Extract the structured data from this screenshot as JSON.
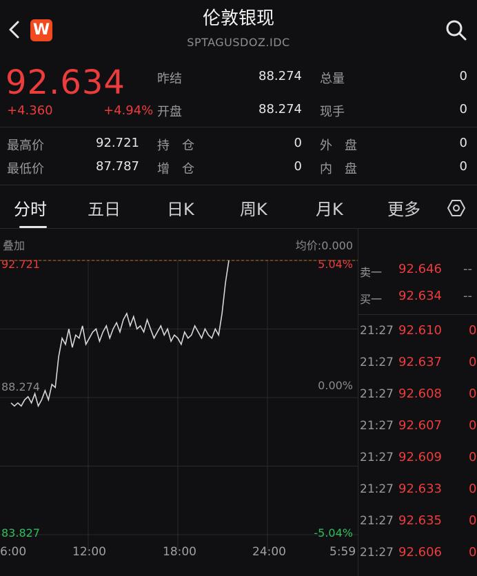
{
  "header": {
    "title": "伦敦银现",
    "symbol": "SPTAGUSDOZ.IDC",
    "logo_letter": "W",
    "icons": [
      "back-chevron-icon",
      "app-logo-icon",
      "search-icon"
    ]
  },
  "quote": {
    "price": "92.634",
    "change": "+4.360",
    "change_pct": "+4.94%",
    "stats": {
      "prev_close_label": "昨结",
      "prev_close": "88.274",
      "total_vol_label": "总量",
      "total_vol": "0",
      "open_label": "开盘",
      "open": "88.274",
      "cur_vol_label": "现手",
      "cur_vol": "0",
      "high_label": "最高价",
      "high": "92.721",
      "hold_label": "持　仓",
      "hold": "0",
      "outer_label": "外　盘",
      "outer": "0",
      "low_label": "最低价",
      "low": "87.787",
      "add_label": "增　仓",
      "add": "0",
      "inner_label": "内　盘",
      "inner": "0"
    }
  },
  "tabs": [
    "分时",
    "五日",
    "日K",
    "周K",
    "月K",
    "更多"
  ],
  "active_tab": 0,
  "chart": {
    "overlay_label": "叠加",
    "avg_label": "均价:0.000",
    "top_price": "92.721",
    "mid_price": "88.274",
    "bottom_price": "83.827",
    "top_pct": "5.04%",
    "mid_pct": "0.00%",
    "bottom_pct": "-5.04%",
    "x_ticks": [
      "6:00",
      "12:00",
      "18:00",
      "24:00",
      "5:59"
    ],
    "colors": {
      "line": "#d8d8d8",
      "up": "#ec3c3c",
      "down": "#2fbf5a",
      "grid": "#2a2a2e",
      "ref": "#c8761e"
    }
  },
  "chart_data": {
    "type": "line",
    "ylim": [
      83.827,
      92.721
    ],
    "reference": 88.274,
    "x": [
      "6:00",
      "12:00",
      "18:00",
      "24:00",
      "5:59"
    ],
    "series": [
      {
        "values": [
          88.1,
          88.0,
          88.1,
          88.0,
          88.2,
          88.3,
          88.1,
          88.4,
          88.0,
          88.2,
          88.5,
          88.2,
          88.7,
          88.6,
          89.6,
          90.2,
          90.0,
          90.5,
          89.9,
          90.3,
          90.2,
          90.6,
          90.0,
          90.2,
          90.4,
          90.5,
          90.1,
          90.4,
          90.6,
          90.2,
          90.5,
          90.7,
          90.4,
          90.8,
          91.0,
          90.6,
          90.9,
          90.5,
          90.6,
          90.4,
          90.8,
          90.5,
          90.2,
          90.4,
          90.6,
          90.3,
          90.5,
          90.1,
          90.3,
          90.2,
          90.0,
          90.4,
          90.2,
          90.3,
          90.6,
          90.4,
          90.2,
          90.5,
          90.3,
          90.2,
          90.5,
          90.3,
          91.0,
          92.0,
          92.721
        ]
      }
    ]
  },
  "order_book": {
    "ask_label": "卖一",
    "ask_price": "92.646",
    "ask_vol": "--",
    "bid_label": "买一",
    "bid_price": "92.634",
    "bid_vol": "--",
    "ticks": [
      {
        "time": "21:27",
        "price": "92.610",
        "vol": "0"
      },
      {
        "time": "21:27",
        "price": "92.637",
        "vol": "0"
      },
      {
        "time": "21:27",
        "price": "92.608",
        "vol": "0"
      },
      {
        "time": "21:27",
        "price": "92.607",
        "vol": "0"
      },
      {
        "time": "21:27",
        "price": "92.609",
        "vol": "0"
      },
      {
        "time": "21:27",
        "price": "92.633",
        "vol": "0"
      },
      {
        "time": "21:27",
        "price": "92.635",
        "vol": "0"
      },
      {
        "time": "21:27",
        "price": "92.606",
        "vol": "0"
      }
    ]
  }
}
